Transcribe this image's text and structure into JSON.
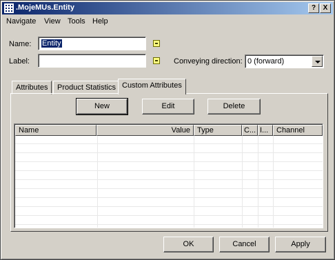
{
  "window": {
    "title": ".MojeMUs.Entity",
    "help_btn": "?",
    "close_btn": "X"
  },
  "menu": [
    "Navigate",
    "View",
    "Tools",
    "Help"
  ],
  "form": {
    "name_label": "Name:",
    "name_value": "Entity",
    "label_label": "Label:",
    "label_value": "",
    "direction_label": "Conveying direction:",
    "direction_value": "0 (forward)"
  },
  "tabs": [
    "Attributes",
    "Product Statistics",
    "Custom Attributes"
  ],
  "active_tab": "Custom Attributes",
  "panel_buttons": {
    "new": "New",
    "edit": "Edit",
    "delete": "Delete"
  },
  "table": {
    "columns": [
      "Name",
      "Value",
      "Type",
      "C...",
      "I...",
      "Channel"
    ],
    "rows": []
  },
  "footer": {
    "ok": "OK",
    "cancel": "Cancel",
    "apply": "Apply"
  },
  "colors": {
    "titlebar_start": "#0a246a",
    "titlebar_end": "#a6caf0",
    "face": "#d4d0c8"
  }
}
